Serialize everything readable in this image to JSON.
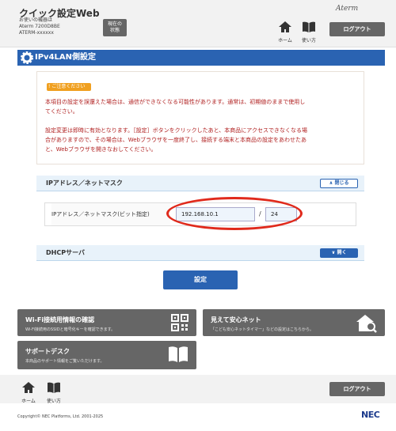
{
  "header": {
    "app_title": "クイック設定Web",
    "device_line1": "お使いの機器は",
    "device_line2": "Aterm 7200D8BE",
    "device_line3": "ATERM-xxxxxx",
    "status_btn_line1": "現在の",
    "status_btn_line2": "状態",
    "brand_logo": "Aterm",
    "home_label": "ホーム",
    "help_label": "使い方",
    "logout_label": "ログアウト"
  },
  "page": {
    "title": "IPv4LAN側設定"
  },
  "warning": {
    "badge": "ご注意ください",
    "line1": "本項目の設定を誤還えた場合は、通信ができなくなる可能性があります。通常は、初期値のままで使用し",
    "line2": "てください。",
    "line3": "設定変更は即時に有効となります。［設定］ボタンをクリックしたあと、本商品にアクセスできなくなる場",
    "line4": "合がありますので、その場合は、Webブラウザを一度終了し、接続する端末と本商品の設定をあわせたあ",
    "line5": "と、Webブラウザを開きなおしてください。"
  },
  "ip_section": {
    "title": "IPアドレス／ネットマスク",
    "toggle_label": "閉じる",
    "field_label": "IPアドレス／ネットマスク(ビット指定)",
    "ip_value": "192.168.10.1",
    "separator": "/",
    "mask_value": "24"
  },
  "dhcp_section": {
    "title": "DHCPサーバ",
    "toggle_label": "開く"
  },
  "set_button": "設定",
  "tiles": {
    "wifi_title": "Wi-Fi接続用情報の確認",
    "wifi_desc": "Wi-Fi接続用のSSIDと暗号化キーを確認できます。",
    "safe_title": "見えて安心ネット",
    "safe_desc": "「こども安心ネットタイマー」などの設定はこちらから。",
    "support_title": "サポートデスク",
    "support_desc": "本商品のサポート情報をご覧いただけます。"
  },
  "footer": {
    "home_label": "ホーム",
    "help_label": "使い方",
    "logout_label": "ログアウト",
    "copyright": "Copyright© NEC Platforms, Ltd. 2001-2025",
    "nec_logo": "NEC"
  },
  "colors": {
    "primary_blue": "#2a63b2",
    "warning_red": "#b02020",
    "highlight_ring": "#e02a1c",
    "dark_button": "#666666"
  }
}
